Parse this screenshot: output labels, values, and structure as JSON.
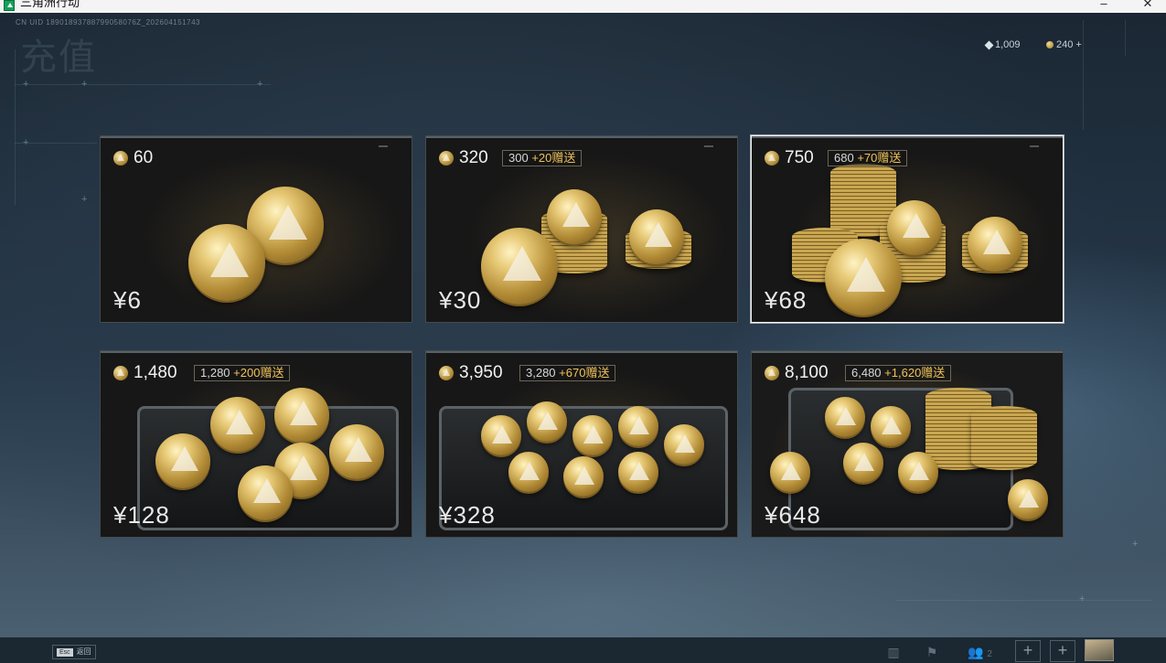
{
  "window": {
    "title": "三角洲行动",
    "minimize_glyph": "–",
    "maximize_glyph": "□",
    "close_glyph": "✕"
  },
  "header": {
    "uid": "CN UID 18901893788799058076Z_202604151743",
    "page_title": "充值",
    "diamond_balance": "1,009",
    "coin_balance": "240",
    "add_glyph": "+"
  },
  "cards": [
    {
      "coins": "60",
      "tag_base": "",
      "tag_bonus": "",
      "price": "¥6"
    },
    {
      "coins": "320",
      "tag_base": "300",
      "tag_bonus": "+20赠送",
      "price": "¥30"
    },
    {
      "coins": "750",
      "tag_base": "680",
      "tag_bonus": "+70赠送",
      "price": "¥68"
    },
    {
      "coins": "1,480",
      "tag_base": "1,280",
      "tag_bonus": "+200赠送",
      "price": "¥128"
    },
    {
      "coins": "3,950",
      "tag_base": "3,280",
      "tag_bonus": "+670赠送",
      "price": "¥328"
    },
    {
      "coins": "8,100",
      "tag_base": "6,480",
      "tag_bonus": "+1,620赠送",
      "price": "¥648"
    }
  ],
  "selected_card": 2,
  "bottom": {
    "esc_key": "Esc",
    "esc_label": "返回",
    "squad_count": "2",
    "plus_glyph": "+"
  },
  "colors": {
    "bonus_accent": "#f0c35a",
    "selected_border": "#f2f2f2",
    "app_icon": "#16a05a"
  },
  "icons": [
    "diamond-icon",
    "coin-icon",
    "stats-icon",
    "flag-icon",
    "squad-icon",
    "plus-icon",
    "avatar"
  ]
}
